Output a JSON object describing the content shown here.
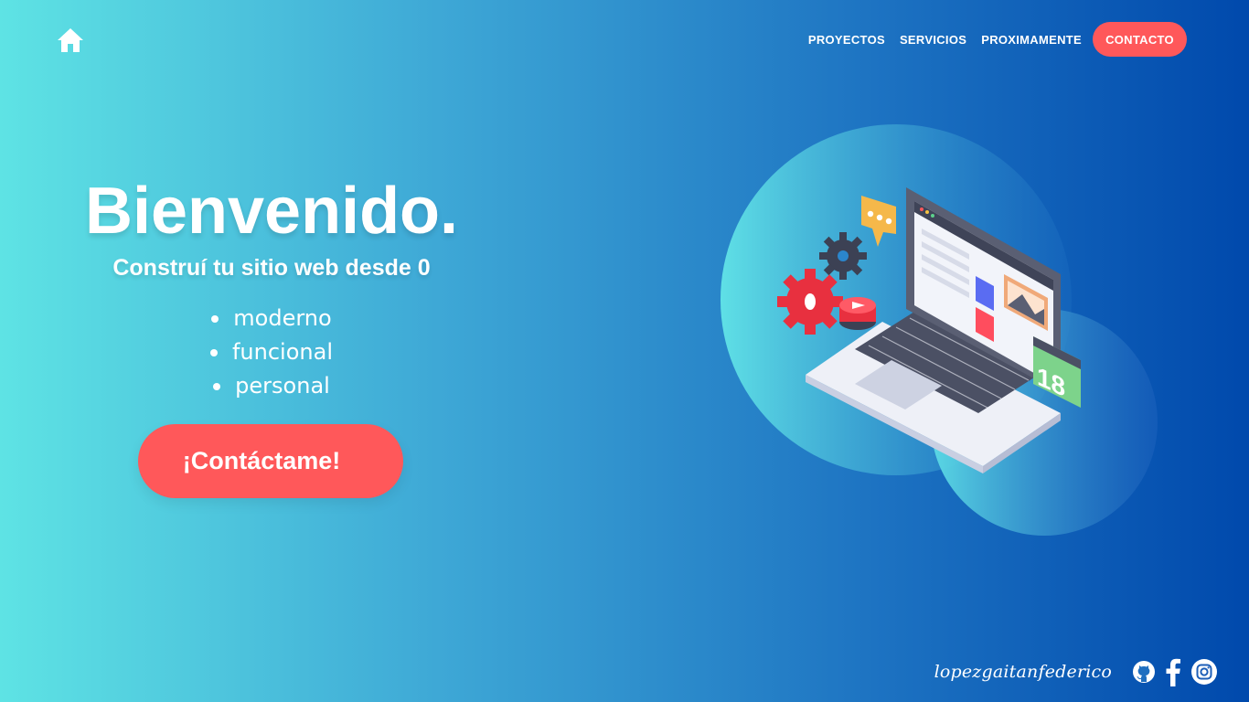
{
  "nav": {
    "home_icon": "home-icon",
    "links": [
      {
        "label": "PROYECTOS"
      },
      {
        "label": "SERVICIOS"
      },
      {
        "label": "PROXIMAMENTE"
      }
    ],
    "cta_label": "CONTACTO"
  },
  "hero": {
    "title": "Bienvenido.",
    "subtitle": "Construí tu sitio web desde 0",
    "features": [
      "moderno",
      "funcional",
      "personal"
    ],
    "button_label": "¡Contáctame!"
  },
  "illustration": {
    "calendar_number": "18",
    "icon": "laptop-illustration"
  },
  "footer": {
    "handle": "lopezgaitanfederico",
    "social_icons": [
      "github-icon",
      "facebook-icon",
      "instagram-icon"
    ]
  },
  "colors": {
    "accent": "#ff585a",
    "gradient_start": "#5ee3e4",
    "gradient_end": "#0049ac",
    "text": "#ffffff"
  }
}
